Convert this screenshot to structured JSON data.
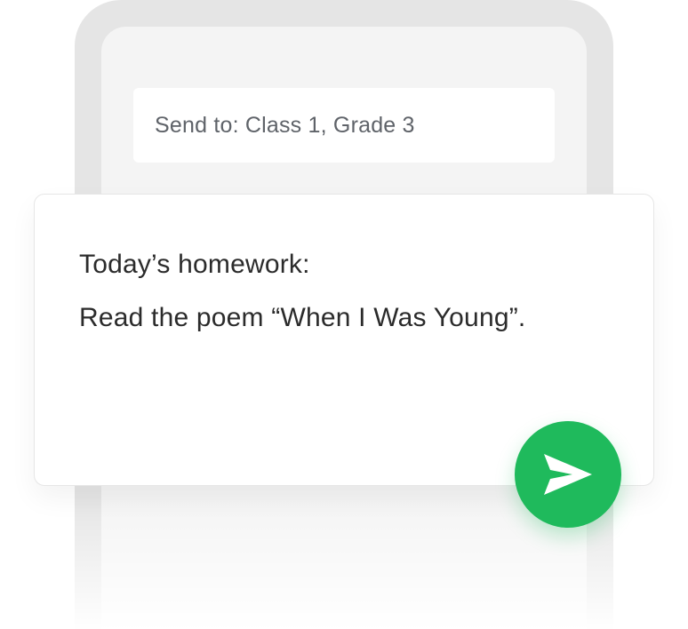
{
  "recipient": {
    "text": "Send to: Class 1, Grade 3"
  },
  "message": {
    "line1": "Today’s homework:",
    "line2": "Read the poem “When I Was Young”."
  },
  "send_button": {
    "icon": "send-icon",
    "color": "#1fba5c"
  }
}
